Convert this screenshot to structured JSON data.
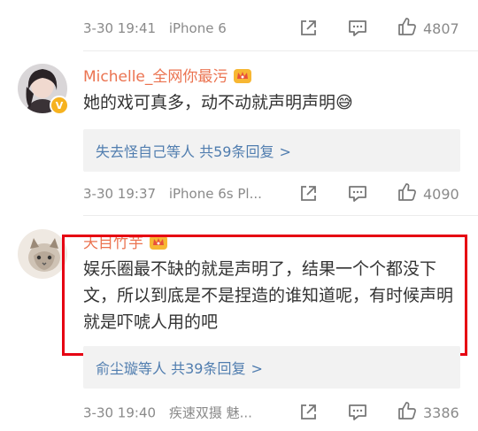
{
  "rows": [
    {
      "meta": {
        "time": "3-30 19:41",
        "device": "iPhone 6"
      },
      "likes": "4807"
    },
    {
      "user": {
        "name": "Michelle_全网你最污"
      },
      "content": "她的戏可真多，动不动就声明声明😅",
      "reply": {
        "names": "失去怪自己",
        "middle": "等人",
        "count": "共59条回复",
        "chevron": ">"
      },
      "meta": {
        "time": "3-30 19:37",
        "device": "iPhone 6s Pl..."
      },
      "likes": "4090"
    },
    {
      "user": {
        "name": "天目竹芋"
      },
      "content": "娱乐圈最不缺的就是声明了，结果一个个都没下文，所以到底是不是捏造的谁知道呢，有时候声明就是吓唬人用的吧",
      "reply": {
        "names": "俞尘璇",
        "middle": "等人",
        "count": "共39条回复",
        "chevron": ">"
      },
      "meta": {
        "time": "3-30 19:40",
        "device": "疾速双摄 魅..."
      },
      "likes": "3386"
    }
  ],
  "icons": {
    "share": "share-icon",
    "comment": "comment-icon",
    "like": "thumbs-up-icon",
    "crown": "crown-badge-icon",
    "verified": "verified-badge-icon"
  },
  "colors": {
    "username": "#eb7350",
    "link": "#507daf",
    "highlight": "#e60012",
    "meta": "#8a8a8a"
  }
}
